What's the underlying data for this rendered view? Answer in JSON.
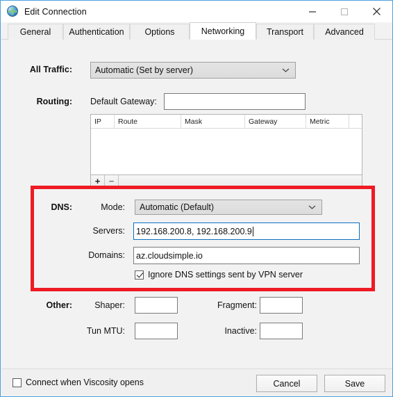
{
  "window": {
    "title": "Edit Connection",
    "icon": "globe-icon",
    "controls": {
      "minimize": "minimize-icon",
      "maximize": "maximize-icon",
      "close": "close-icon"
    }
  },
  "tabs": [
    {
      "label": "General",
      "active": false
    },
    {
      "label": "Authentication",
      "active": false
    },
    {
      "label": "Options",
      "active": false
    },
    {
      "label": "Networking",
      "active": true
    },
    {
      "label": "Transport",
      "active": false
    },
    {
      "label": "Advanced",
      "active": false
    }
  ],
  "all_traffic": {
    "label": "All Traffic:",
    "mode_value": "Automatic (Set by server)",
    "chevron": "chevron-down-icon"
  },
  "routing": {
    "label": "Routing:",
    "gateway_label": "Default Gateway:",
    "gateway_value": "",
    "gateway_placeholder": "",
    "columns": [
      "IP",
      "Route",
      "Mask",
      "Gateway",
      "Metric"
    ],
    "rows": [],
    "add_button": "+",
    "remove_button": "−"
  },
  "dns": {
    "label": "DNS:",
    "mode_label": "Mode:",
    "mode_value": "Automatic (Default)",
    "chevron": "chevron-down-icon",
    "servers_label": "Servers:",
    "servers_value": "192.168.200.8, 192.168.200.9",
    "domains_label": "Domains:",
    "domains_value": "az.cloudsimple.io",
    "ignore_label": "Ignore DNS settings sent by VPN server",
    "ignore_checked": true,
    "highlight_color": "#ee1b24"
  },
  "other": {
    "label": "Other:",
    "shaper_label": "Shaper:",
    "shaper_value": "",
    "fragment_label": "Fragment:",
    "fragment_value": "",
    "tun_mtu_label": "Tun MTU:",
    "tun_mtu_value": "",
    "inactive_label": "Inactive:",
    "inactive_value": ""
  },
  "footer": {
    "connect_label": "Connect when Viscosity opens",
    "connect_checked": false,
    "cancel_label": "Cancel",
    "save_label": "Save"
  }
}
